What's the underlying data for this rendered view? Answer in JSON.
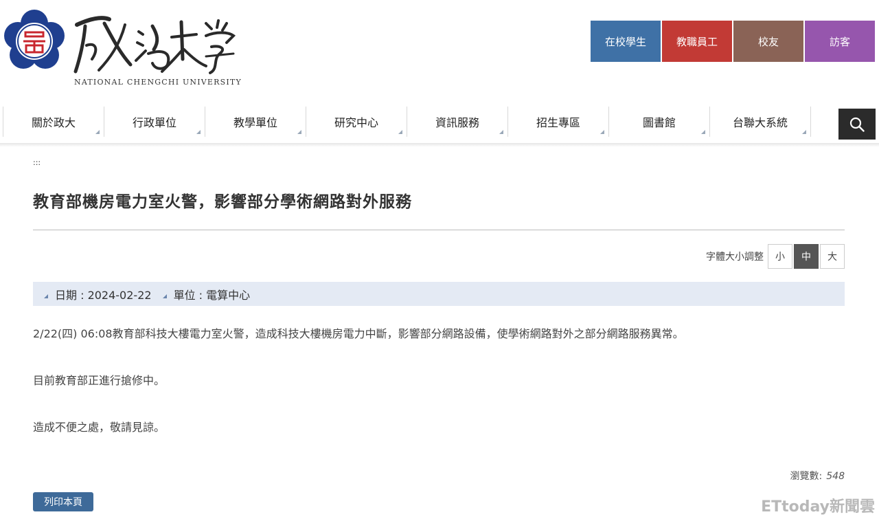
{
  "brand": {
    "subtitle": "NATIONAL CHENGCHI UNIVERSITY",
    "emblem_color": "#1f3f8f",
    "emblem_accent": "#c8262e"
  },
  "audience_links": [
    {
      "label": "在校學生",
      "color": "#3f71a6"
    },
    {
      "label": "教職員工",
      "color": "#c23a35"
    },
    {
      "label": "校友",
      "color": "#8a6356"
    },
    {
      "label": "訪客",
      "color": "#9656ad"
    }
  ],
  "main_nav": [
    {
      "label": "關於政大"
    },
    {
      "label": "行政單位"
    },
    {
      "label": "教學單位"
    },
    {
      "label": "研究中心"
    },
    {
      "label": "資訊服務"
    },
    {
      "label": "招生專區"
    },
    {
      "label": "圖書館"
    },
    {
      "label": "台聯大系統"
    }
  ],
  "search": {
    "icon": "search-icon"
  },
  "accesskey": ":::",
  "article": {
    "title": "教育部機房電力室火警，影響部分學術網路對外服務",
    "font_size_label": "字體大小調整",
    "font_size_options": [
      "小",
      "中",
      "大"
    ],
    "font_size_selected": "中",
    "date_label": "日期 : 2024-02-22",
    "unit_label": "單位 : 電算中心",
    "paragraphs": [
      "2/22(四) 06:08教育部科技大樓電力室火警，造成科技大樓機房電力中斷，影響部分網路設備，使學術網路對外之部分網路服務異常。",
      "目前教育部正進行搶修中。",
      "造成不便之處，敬請見諒。"
    ],
    "views_label": "瀏覽數:",
    "views_count": "548",
    "print_label": "列印本頁"
  },
  "watermark": "ETtoday新聞雲"
}
